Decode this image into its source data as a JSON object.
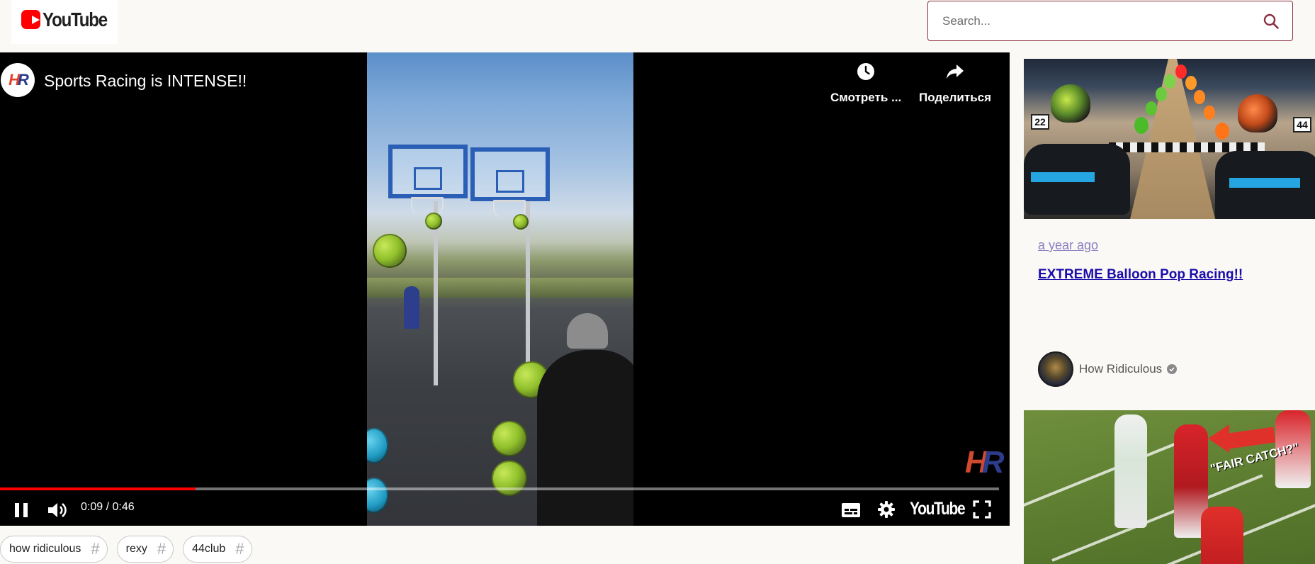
{
  "header": {
    "logo_text": "YouTube",
    "search_placeholder": "Search..."
  },
  "player": {
    "title": "Sports Racing is INTENSE!!",
    "channel_logo_letters": [
      "H",
      "R"
    ],
    "watch_later_label": "Смотреть ...",
    "share_label": "Поделиться",
    "current_time": "0:09",
    "duration": "0:46",
    "time_display": "0:09 / 0:46",
    "progress_fraction": 0.196,
    "controls_logo_text": "YouTube",
    "watermark_letters": [
      "H",
      "R"
    ]
  },
  "tags": [
    {
      "label": "how ridiculous",
      "icon": "hash-icon"
    },
    {
      "label": "rexy",
      "icon": "hash-icon"
    },
    {
      "label": "44club",
      "icon": "hash-icon"
    }
  ],
  "sidebar": {
    "cards": [
      {
        "age": "a year ago",
        "title": "EXTREME Balloon Pop Racing!!",
        "channel": "How Ridiculous",
        "verified": true,
        "kart_numbers": [
          "22",
          "44"
        ]
      },
      {
        "thumbnail_text": "\"FAIR CATCH?\""
      }
    ]
  },
  "colors": {
    "accent_red": "#ff0000",
    "search_border": "#8a2f3f",
    "link_blue": "#1a0dab",
    "visited_purple": "#8a7fc4",
    "page_bg": "#fbf9f5"
  }
}
